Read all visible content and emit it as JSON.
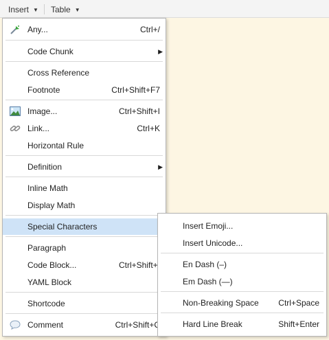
{
  "toolbar": {
    "insert_label": "Insert",
    "table_label": "Table"
  },
  "menu": {
    "any": {
      "label": "Any...",
      "shortcut": "Ctrl+/"
    },
    "code_chunk": {
      "label": "Code Chunk"
    },
    "cross_reference": {
      "label": "Cross Reference"
    },
    "footnote": {
      "label": "Footnote",
      "shortcut": "Ctrl+Shift+F7"
    },
    "image": {
      "label": "Image...",
      "shortcut": "Ctrl+Shift+I"
    },
    "link": {
      "label": "Link...",
      "shortcut": "Ctrl+K"
    },
    "horizontal_rule": {
      "label": "Horizontal Rule"
    },
    "definition": {
      "label": "Definition"
    },
    "inline_math": {
      "label": "Inline Math"
    },
    "display_math": {
      "label": "Display Math"
    },
    "special_characters": {
      "label": "Special Characters"
    },
    "paragraph": {
      "label": "Paragraph"
    },
    "code_block": {
      "label": "Code Block...",
      "shortcut": "Ctrl+Shift+\\"
    },
    "yaml_block": {
      "label": "YAML Block"
    },
    "shortcode": {
      "label": "Shortcode"
    },
    "comment": {
      "label": "Comment",
      "shortcut": "Ctrl+Shift+C"
    }
  },
  "submenu": {
    "insert_emoji": {
      "label": "Insert Emoji..."
    },
    "insert_unicode": {
      "label": "Insert Unicode..."
    },
    "en_dash": {
      "label": "En Dash (–)"
    },
    "em_dash": {
      "label": "Em Dash (—)"
    },
    "non_breaking_space": {
      "label": "Non-Breaking Space",
      "shortcut": "Ctrl+Space"
    },
    "hard_line_break": {
      "label": "Hard Line Break",
      "shortcut": "Shift+Enter"
    }
  },
  "colors": {
    "editor_background": "#fdf6e3",
    "highlight": "#cfe3f7",
    "menu_border": "#b5b5b5"
  },
  "icons": {
    "any": "magic-wand-icon",
    "image": "image-icon",
    "link": "link-icon",
    "comment": "speech-bubble-icon",
    "submenu_arrow": "triangle-right-icon"
  }
}
